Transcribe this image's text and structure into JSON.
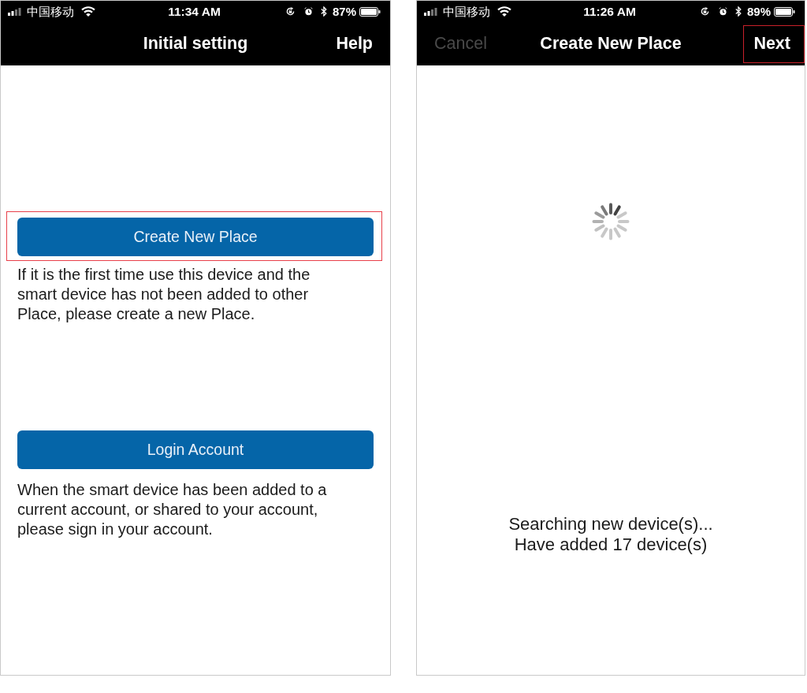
{
  "screens": [
    {
      "status_bar": {
        "carrier": "中国移动",
        "time": "11:34 AM",
        "battery": "87%"
      },
      "nav_bar": {
        "title": "Initial setting",
        "right_button": {
          "label": "Help",
          "disabled": false,
          "highlighted": false
        }
      },
      "body": {
        "kind": "actions",
        "sections": [
          {
            "button": "Create New Place",
            "highlighted": true,
            "description": "If it is the first time use this device and the smart device has not been added to other Place, please create a new Place."
          },
          {
            "button": "Login Account",
            "highlighted": false,
            "description": "When the smart device has been added to a current account, or shared to your account, please sign in your account."
          }
        ]
      }
    },
    {
      "status_bar": {
        "carrier": "中国移动",
        "time": "11:26 AM",
        "battery": "89%"
      },
      "nav_bar": {
        "left_button": {
          "label": "Cancel",
          "disabled": true,
          "highlighted": false
        },
        "title": "Create New Place",
        "right_button": {
          "label": "Next",
          "disabled": false,
          "highlighted": true
        }
      },
      "body": {
        "kind": "progress",
        "messages": [
          "Searching new device(s)...",
          "Have added 17 device(s)"
        ]
      }
    }
  ]
}
